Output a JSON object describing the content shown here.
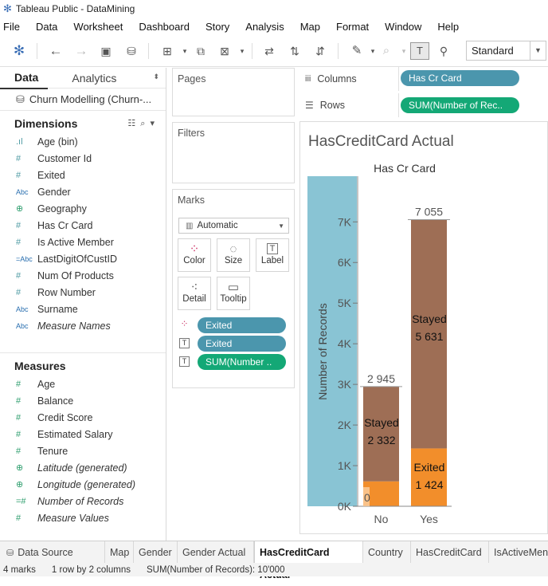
{
  "window": {
    "title": "Tableau Public - DataMining"
  },
  "menu": [
    "File",
    "Data",
    "Worksheet",
    "Dashboard",
    "Story",
    "Analysis",
    "Map",
    "Format",
    "Window",
    "Help"
  ],
  "toolbar": {
    "view_mode": "Standard"
  },
  "data_pane": {
    "tabs": {
      "data": "Data",
      "analytics": "Analytics"
    },
    "datasource": "Churn Modelling (Churn-...",
    "dimensions_label": "Dimensions",
    "dimensions": [
      {
        "name": "Age (bin)",
        "icon": "bin-icon"
      },
      {
        "name": "Customer Id",
        "icon": "hash-icon"
      },
      {
        "name": "Exited",
        "icon": "hash-icon"
      },
      {
        "name": "Gender",
        "icon": "abc-icon"
      },
      {
        "name": "Geography",
        "icon": "globe-icon"
      },
      {
        "name": "Has Cr Card",
        "icon": "hash-icon"
      },
      {
        "name": "Is Active Member",
        "icon": "hash-icon"
      },
      {
        "name": "LastDigitOfCustID",
        "icon": "calc-abc-icon"
      },
      {
        "name": "Num Of Products",
        "icon": "hash-icon"
      },
      {
        "name": "Row Number",
        "icon": "hash-icon"
      },
      {
        "name": "Surname",
        "icon": "abc-icon"
      },
      {
        "name": "Measure Names",
        "icon": "abc-icon",
        "italic": true
      }
    ],
    "measures_label": "Measures",
    "measures": [
      {
        "name": "Age",
        "icon": "hash-icon"
      },
      {
        "name": "Balance",
        "icon": "hash-icon"
      },
      {
        "name": "Credit Score",
        "icon": "hash-icon"
      },
      {
        "name": "Estimated Salary",
        "icon": "hash-icon"
      },
      {
        "name": "Tenure",
        "icon": "hash-icon"
      },
      {
        "name": "Latitude (generated)",
        "icon": "globe-icon",
        "italic": true
      },
      {
        "name": "Longitude (generated)",
        "icon": "globe-icon",
        "italic": true
      },
      {
        "name": "Number of Records",
        "icon": "calc-hash-icon",
        "italic": true
      },
      {
        "name": "Measure Values",
        "icon": "hash-icon",
        "italic": true
      }
    ]
  },
  "cards": {
    "pages": "Pages",
    "filters": "Filters",
    "marks": "Marks"
  },
  "marks": {
    "type": "Automatic",
    "buttons": [
      "Color",
      "Size",
      "Label",
      "Detail",
      "Tooltip"
    ],
    "pills": [
      {
        "icon": "color-dots-icon",
        "label": "Exited",
        "color": "#4b96ad"
      },
      {
        "icon": "label-icon",
        "label": "Exited",
        "color": "#4b96ad"
      },
      {
        "icon": "label-icon",
        "label": "SUM(Number ..",
        "color": "#14a876"
      }
    ]
  },
  "shelves": {
    "columns_label": "Columns",
    "rows_label": "Rows",
    "columns_pill": "Has Cr Card",
    "rows_pill": "SUM(Number of Rec.."
  },
  "sheet_title": "HasCreditCard Actual",
  "chart_data": {
    "type": "bar",
    "stacked": true,
    "title": "Has Cr Card",
    "xlabel": "",
    "ylabel": "Number of Records",
    "categories": [
      "No",
      "Yes"
    ],
    "series": [
      {
        "name": "Exited",
        "label": "Exited",
        "color": "#f28e2b",
        "values": [
          613,
          1424
        ]
      },
      {
        "name": "Stayed",
        "label": "Stayed",
        "color": "#9e6e55",
        "values": [
          2332,
          5631
        ]
      }
    ],
    "totals": [
      "2 945",
      "7 055"
    ],
    "value_labels": {
      "No": {
        "Exited": "0",
        "Stayed": "2 332"
      },
      "Yes": {
        "Exited": "1 424",
        "Stayed": "5 631"
      }
    },
    "ticks": [
      "0K",
      "1K",
      "2K",
      "3K",
      "4K",
      "5K",
      "6K",
      "7K"
    ],
    "ylim": [
      0,
      7300
    ],
    "axis_band_color": "#89c4d4"
  },
  "sheet_tabs": [
    "Data Source",
    "Map",
    "Gender",
    "Gender Actual",
    "HasCreditCard Actual",
    "Country",
    "HasCreditCard",
    "IsActiveMen"
  ],
  "active_tab": "HasCreditCard Actual",
  "status": {
    "marks": "4 marks",
    "grid": "1 row by 2 columns",
    "sum": "SUM(Number of Records): 10'000"
  }
}
